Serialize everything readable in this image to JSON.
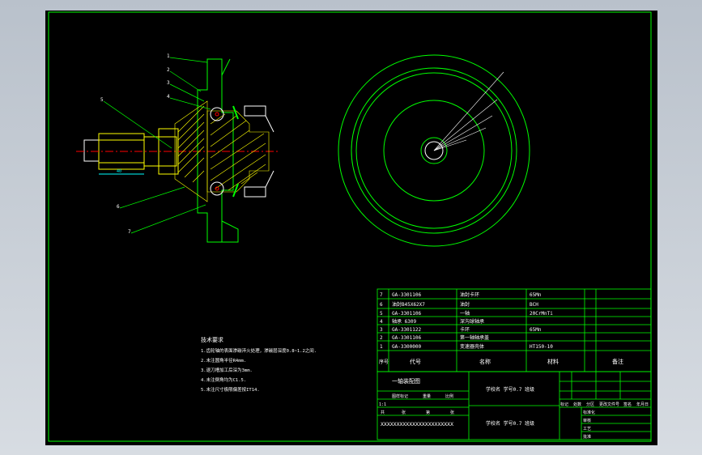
{
  "parts_table": {
    "rows": [
      {
        "no": "7",
        "code": "GA-3301106",
        "name": "油封卡环",
        "material": "65Mn"
      },
      {
        "no": "6",
        "code": "油封B45X62X7",
        "name": "油封",
        "material": "BCH"
      },
      {
        "no": "5",
        "code": "GA-3301106",
        "name": "一轴",
        "material": "20CrMnTi"
      },
      {
        "no": "4",
        "code": "轴承 6309",
        "name": "深沟球轴承",
        "material": ""
      },
      {
        "no": "3",
        "code": "GA-3301122",
        "name": "卡环",
        "material": "65Mn"
      },
      {
        "no": "2",
        "code": "GA-3301106",
        "name": "第一轴轴承盖",
        "material": ""
      },
      {
        "no": "1",
        "code": "GA-3300000",
        "name": "变速器壳体",
        "material": "HT150-10"
      }
    ],
    "header": {
      "no": "序号",
      "code": "代号",
      "name": "名称",
      "material": "材料",
      "remark": "备注"
    }
  },
  "title_block": {
    "drawing_name": "一轴装配图",
    "designer_line1": "学校名  学号0.7  班级",
    "designer_line2": "学校名  学号0.7  班级",
    "small_headers": [
      "图样标记",
      "重量",
      "比例"
    ],
    "left_cells": [
      "标记",
      "处数",
      "分区",
      "更改文件号",
      "签名",
      "年月日"
    ],
    "sheet_labels": [
      "共",
      "张",
      "第",
      "张"
    ],
    "ratio": "1:1",
    "serial_placeholder": "XXXXXXXXXXXXXXXXXXXXXXX",
    "right_labels": [
      "标准化",
      "审核",
      "工艺",
      "批准"
    ]
  },
  "tech_notes": {
    "title": "技术要求",
    "items": [
      "1.齿轮轴的表面渗碳淬火处理，渗碳层深度0.8~1.2之间.",
      "2.未注圆角半径R4mm.",
      "3.退刀槽加工后深为3mm.",
      "4.未注倒角均为C1.5.",
      "5.未注尺寸极限偏差按IT14."
    ]
  },
  "balloons": [
    "1",
    "2",
    "3",
    "4",
    "5",
    "6",
    "7"
  ],
  "colors": {
    "background": "#000000",
    "outline": "#00ff00",
    "accent": "#ffff00",
    "hatch": "#ffff00",
    "center": "#ff0000",
    "dim": "#00ffff",
    "white": "#ffffff"
  }
}
